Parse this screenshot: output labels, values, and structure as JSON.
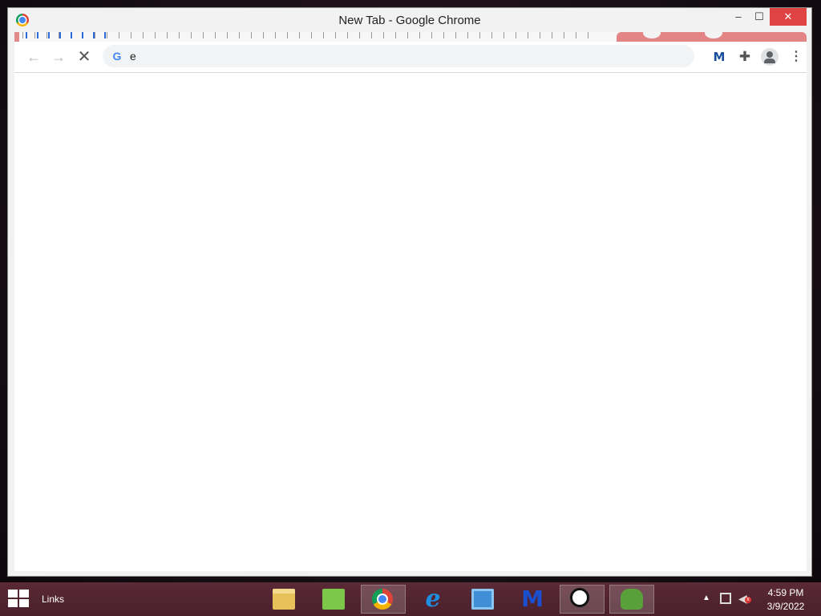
{
  "window": {
    "title": "New Tab - Google Chrome",
    "controls": {
      "minimize": "–",
      "maximize": "☐",
      "close": "✕"
    }
  },
  "toolbar": {
    "back_glyph": "←",
    "forward_glyph": "→",
    "stop_glyph": "✕",
    "omnibox_icon": "G",
    "omnibox_value": "e",
    "extension_malwarebytes": "M",
    "extensions_glyph": "✚",
    "menu_glyph": "⋮"
  },
  "taskbar": {
    "links_label": "Links",
    "apps": [
      {
        "name": "file-explorer",
        "active": false
      },
      {
        "name": "notepad-plus-plus",
        "active": false
      },
      {
        "name": "google-chrome",
        "active": true
      },
      {
        "name": "internet-explorer",
        "active": false
      },
      {
        "name": "control-panel",
        "active": false
      },
      {
        "name": "malwarebytes",
        "active": false
      },
      {
        "name": "cursor-tool",
        "active": true
      },
      {
        "name": "frog-app",
        "active": true
      }
    ],
    "ie_glyph": "e",
    "malwarebytes_glyph": "M",
    "tray": {
      "up_arrow": "▲",
      "volume_glyph": "◀",
      "volume_mute": "x",
      "time": "4:59 PM",
      "date": "3/9/2022"
    }
  },
  "colors": {
    "close_button": "#e04343",
    "tab_accent": "#e38585",
    "taskbar": "#5a2a36"
  }
}
